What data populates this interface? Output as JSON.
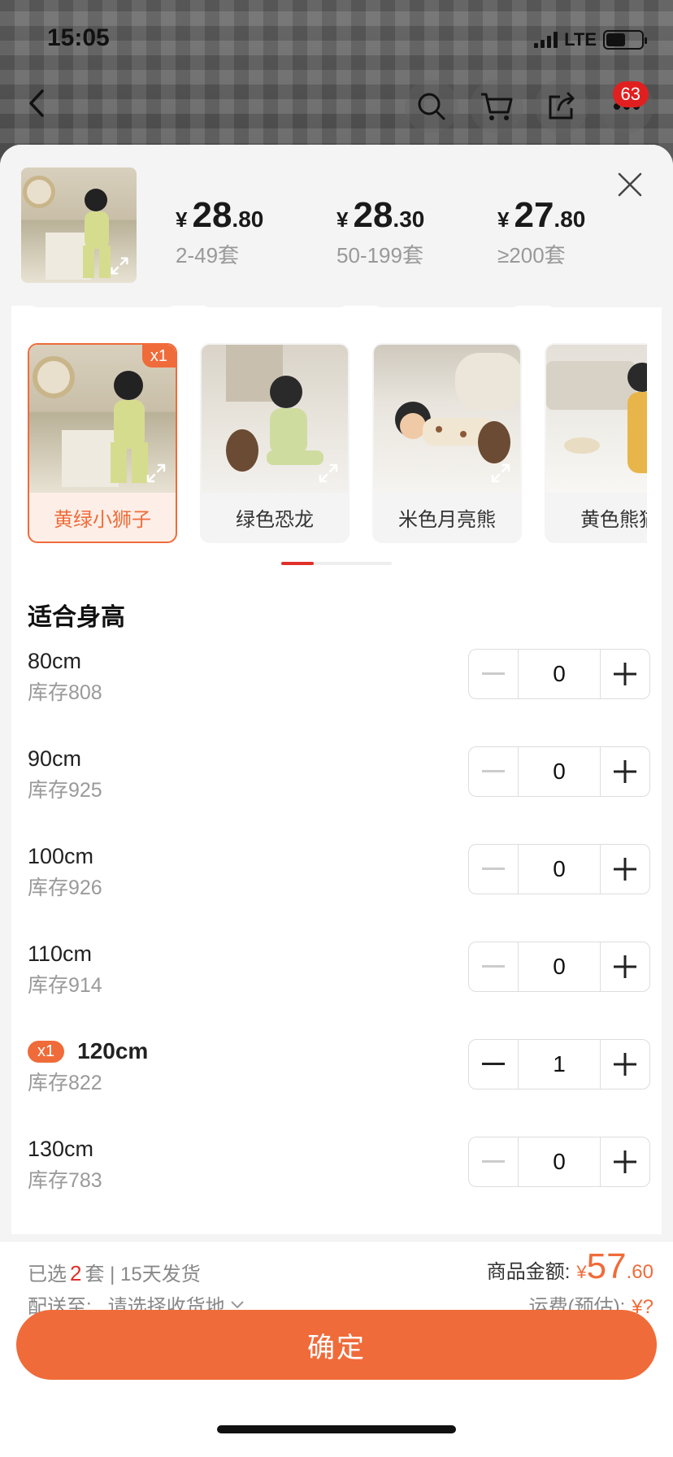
{
  "status": {
    "time": "15:05",
    "network": "LTE"
  },
  "topnav": {
    "cart_badge": "63"
  },
  "prices": [
    {
      "yen": "¥",
      "int": "28",
      "dec": ".80",
      "range": "2-49套"
    },
    {
      "yen": "¥",
      "int": "28",
      "dec": ".30",
      "range": "50-199套"
    },
    {
      "yen": "¥",
      "int": "27",
      "dec": ".80",
      "range": "≥200套"
    }
  ],
  "variants": [
    {
      "label": "黄绿小狮子",
      "badge": "x1",
      "selected": true
    },
    {
      "label": "绿色恐龙"
    },
    {
      "label": "米色月亮熊"
    },
    {
      "label": "黄色熊猫"
    }
  ],
  "section_title": "适合身高",
  "sizes": [
    {
      "size": "80cm",
      "stock": "库存808",
      "qty": "0"
    },
    {
      "size": "90cm",
      "stock": "库存925",
      "qty": "0"
    },
    {
      "size": "100cm",
      "stock": "库存926",
      "qty": "0"
    },
    {
      "size": "110cm",
      "stock": "库存914",
      "qty": "0"
    },
    {
      "size": "120cm",
      "stock": "库存822",
      "qty": "1",
      "badge": "x1"
    },
    {
      "size": "130cm",
      "stock": "库存783",
      "qty": "0"
    }
  ],
  "bottom": {
    "selected_prefix": "已选",
    "selected_count": "2",
    "selected_suffix": "套 | 15天发货",
    "ship_label": "配送至:",
    "ship_value": "请选择收货地",
    "total_label": "商品金额:",
    "total_yen": "¥",
    "total_int": "57",
    "total_dec": ".60",
    "freight_label": "运费(预估):",
    "freight_value": "¥?",
    "confirm_label": "确定"
  },
  "colors": {
    "accent": "#f06b3a",
    "red": "#e0302a"
  }
}
